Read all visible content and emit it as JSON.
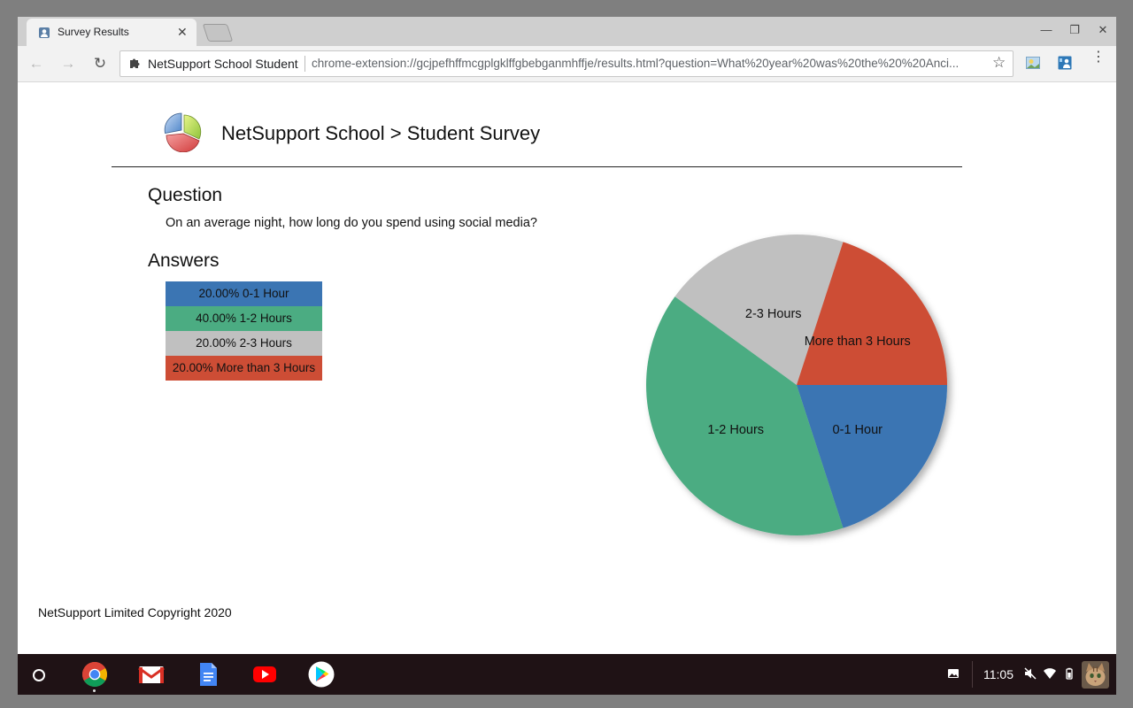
{
  "browser": {
    "tab": {
      "title": "Survey Results",
      "close_label": "✕"
    },
    "window_controls": {
      "minimize": "—",
      "restore": "❐",
      "close": "✕"
    },
    "nav": {
      "back": "←",
      "forward": "→",
      "reload": "↻"
    },
    "omnibox": {
      "site_name": "NetSupport School Student",
      "url": "chrome-extension://gcjpefhffmcgplgklffgbebganmhffje/results.html?question=What%20year%20was%20the%20%20Anci..."
    },
    "star_glyph": "☆",
    "menu_glyph": "⋮"
  },
  "page": {
    "title": "NetSupport School > Student Survey",
    "question_heading": "Question",
    "question_text": "On an average night, how long do you spend using social media?",
    "answers_heading": "Answers",
    "answers": [
      {
        "label": "20.00% 0-1 Hour",
        "color": "#3b75b3"
      },
      {
        "label": "40.00% 1-2 Hours",
        "color": "#4bac82"
      },
      {
        "label": "20.00% 2-3 Hours",
        "color": "#c0c0c0"
      },
      {
        "label": "20.00% More than 3 Hours",
        "color": "#cd4d35"
      }
    ],
    "footer": "NetSupport Limited Copyright 2020"
  },
  "chart_data": {
    "type": "pie",
    "categories": [
      "0-1 Hour",
      "1-2 Hours",
      "2-3 Hours",
      "More than 3 Hours"
    ],
    "values": [
      20,
      40,
      20,
      20
    ],
    "colors": [
      "#3b75b3",
      "#4bac82",
      "#c0c0c0",
      "#cd4d35"
    ]
  },
  "shelf": {
    "apps": [
      "chrome-icon",
      "gmail-icon",
      "docs-icon",
      "youtube-icon",
      "play-store-icon"
    ],
    "clock": "11:05"
  }
}
